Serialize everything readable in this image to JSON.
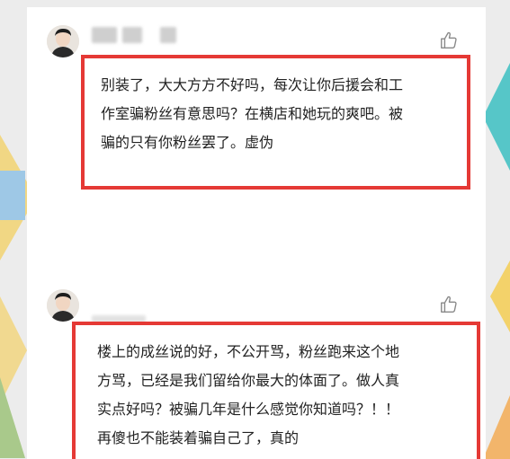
{
  "comments": [
    {
      "lines": [
        "别装了，大大方方不好吗，每次让你后援会和工",
        "作室骗粉丝有意思吗？在横店和她玩的爽吧。被",
        "骗的只有你粉丝罢了。虚伪"
      ]
    },
    {
      "lines": [
        "楼上的成丝说的好，不公开骂，粉丝跑来这个地",
        "方骂，已经是我们留给你最大的体面了。做人真",
        "实点好吗？被骗几年是什么感觉你知道吗？！！",
        "再傻也不能装着骗自己了，真的"
      ]
    }
  ],
  "icons": {
    "like": "thumbs-up-icon",
    "avatar": "user-avatar"
  },
  "colors": {
    "highlight_border": "#e53935",
    "text": "#222222"
  }
}
